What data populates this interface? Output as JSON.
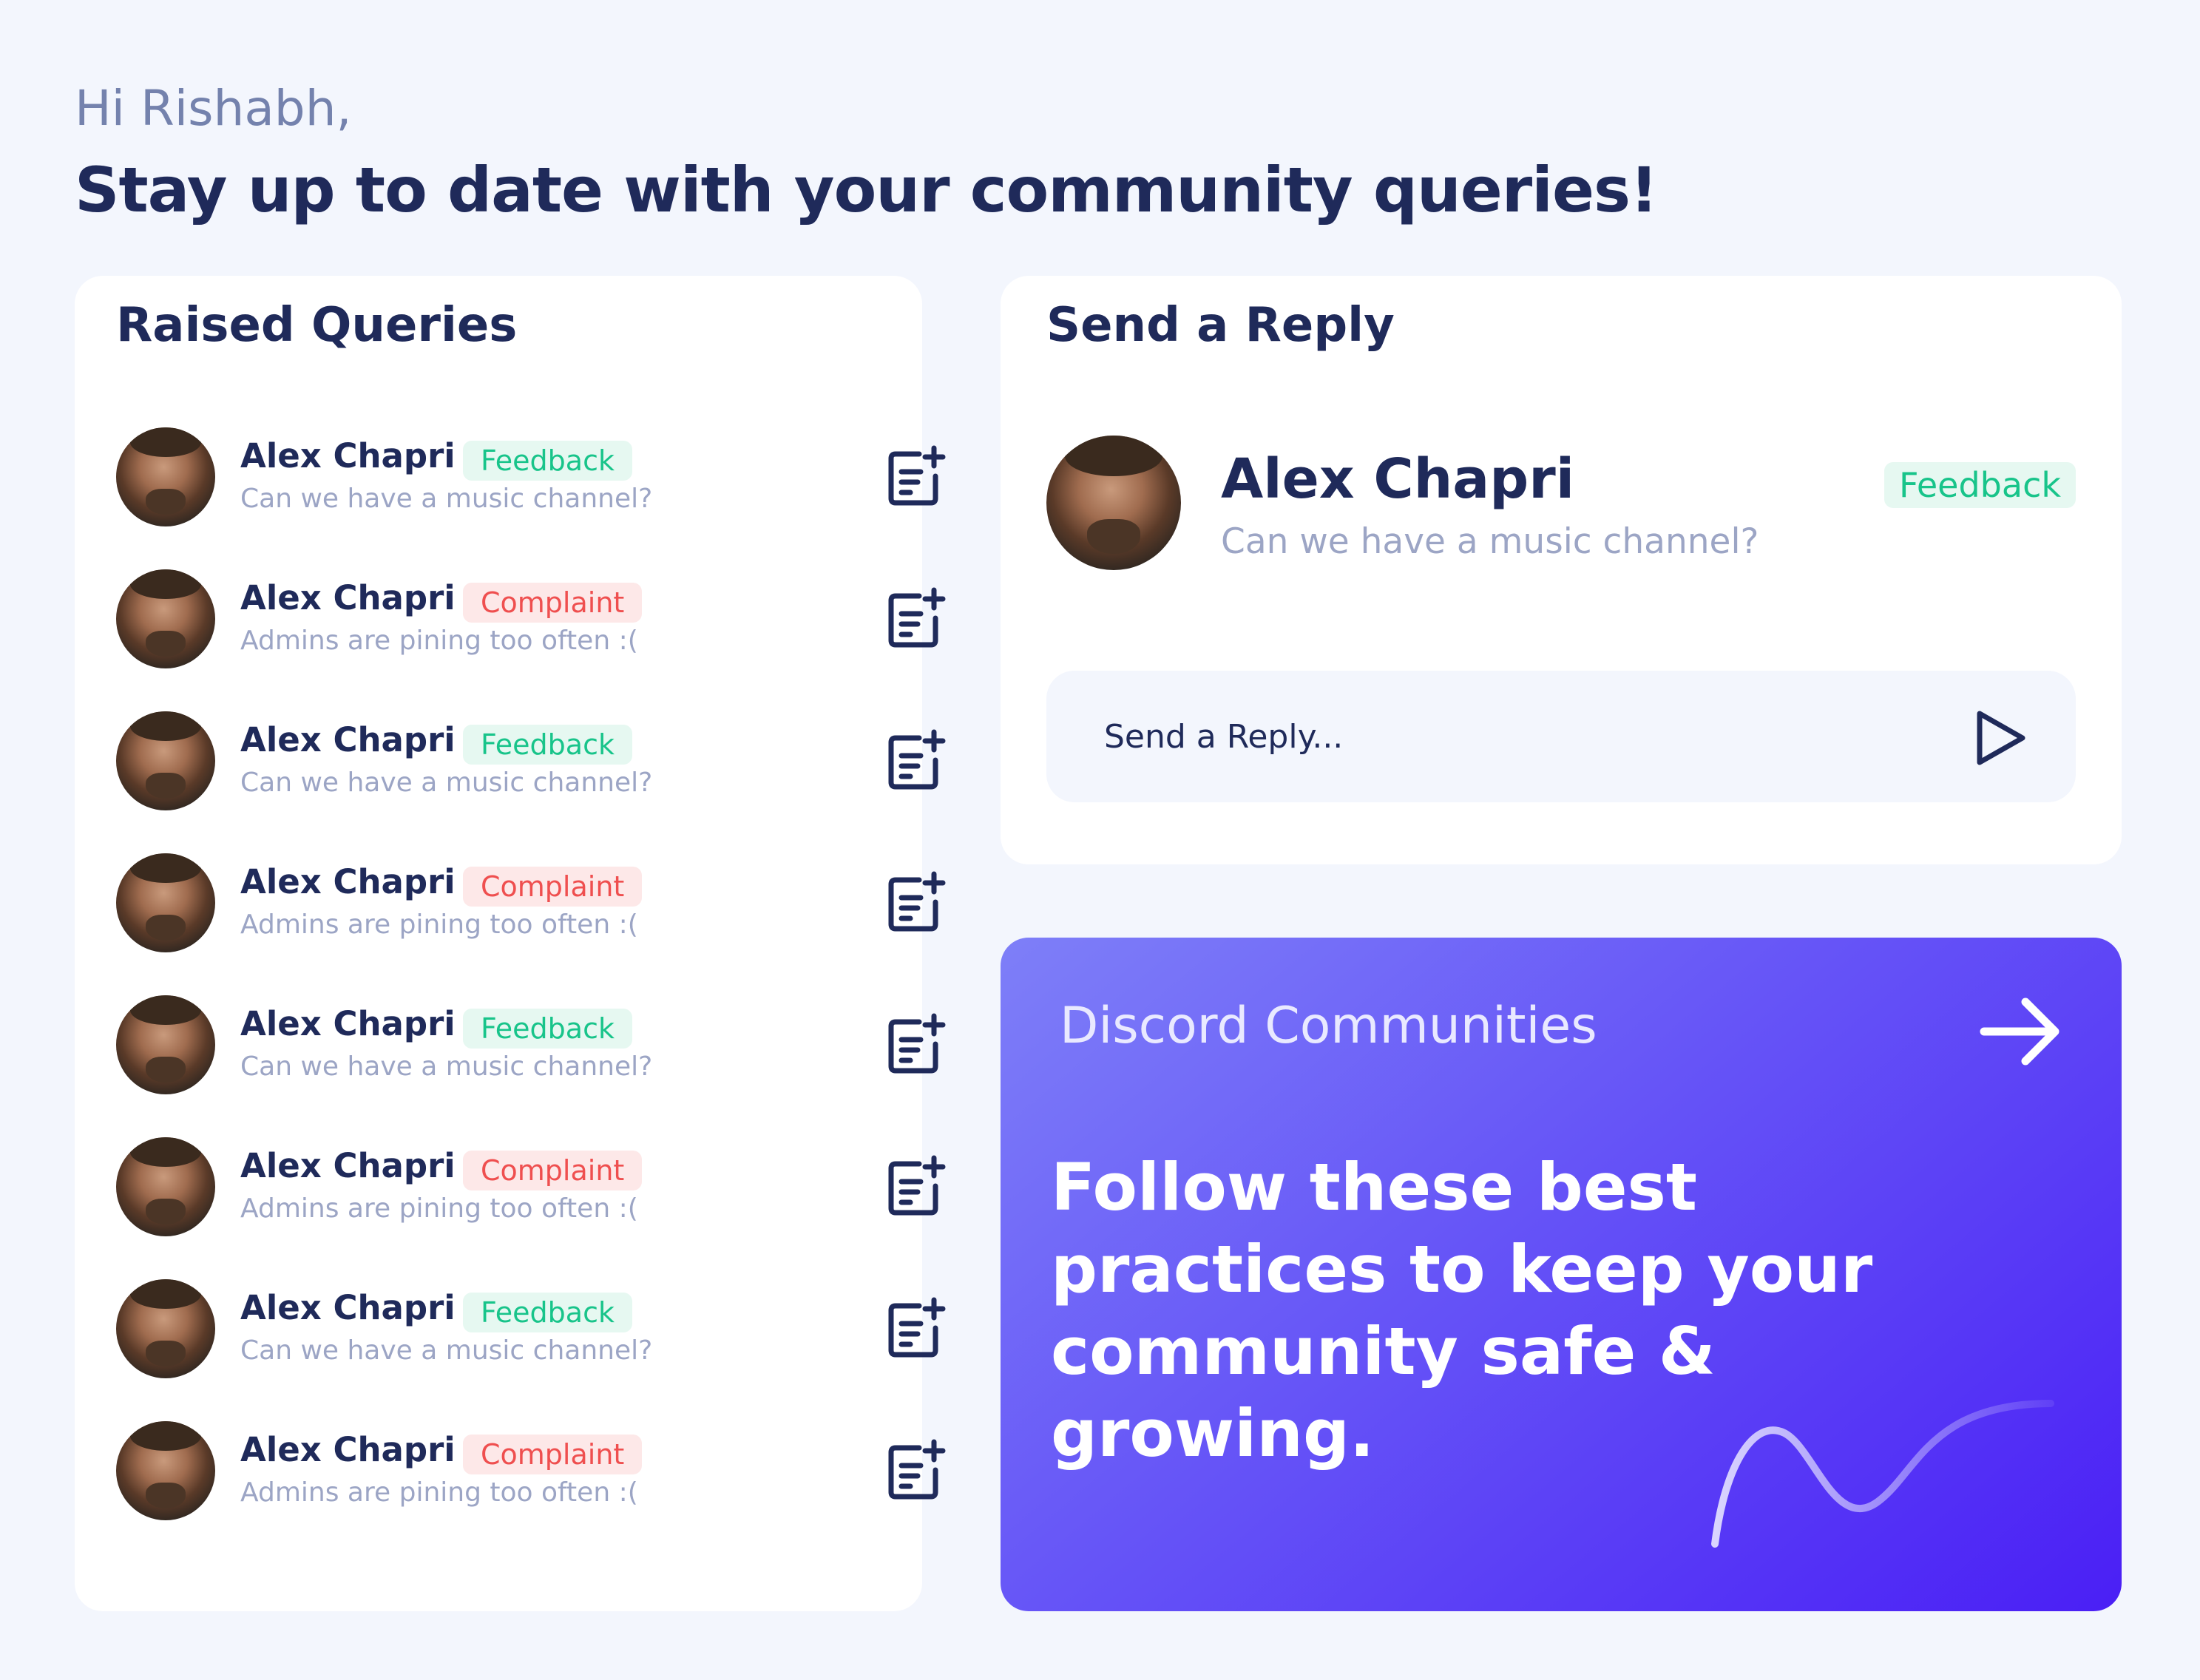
{
  "header": {
    "greeting": "Hi Rishabh,",
    "headline": "Stay up to date with your community queries!"
  },
  "queries": {
    "title": "Raised Queries",
    "items": [
      {
        "name": "Alex Chapri",
        "tag": "Feedback",
        "tag_type": "feedback",
        "message": "Can we have a music channel?"
      },
      {
        "name": "Alex Chapri",
        "tag": "Complaint",
        "tag_type": "complaint",
        "message": "Admins are pining too often :("
      },
      {
        "name": "Alex Chapri",
        "tag": "Feedback",
        "tag_type": "feedback",
        "message": "Can we have a music channel?"
      },
      {
        "name": "Alex Chapri",
        "tag": "Complaint",
        "tag_type": "complaint",
        "message": "Admins are pining too often :("
      },
      {
        "name": "Alex Chapri",
        "tag": "Feedback",
        "tag_type": "feedback",
        "message": "Can we have a music channel?"
      },
      {
        "name": "Alex Chapri",
        "tag": "Complaint",
        "tag_type": "complaint",
        "message": "Admins are pining too often :("
      },
      {
        "name": "Alex Chapri",
        "tag": "Feedback",
        "tag_type": "feedback",
        "message": "Can we have a music channel?"
      },
      {
        "name": "Alex Chapri",
        "tag": "Complaint",
        "tag_type": "complaint",
        "message": "Admins are pining too often :("
      }
    ],
    "row_icon": "note-add-icon"
  },
  "reply": {
    "title": "Send a Reply",
    "name": "Alex Chapri",
    "message": "Can we have a music channel?",
    "tag": "Feedback",
    "input_placeholder": "Send a Reply...",
    "send_icon": "send-icon"
  },
  "discord": {
    "title": "Discord Communities",
    "text": "Follow these best practices to keep your community safe & growing.",
    "arrow_icon": "arrow-right-icon"
  },
  "colors": {
    "background": "#f3f6fd",
    "primary_text": "#1f2a5a",
    "muted_text": "#9ca5c5",
    "feedback": "#18c48a",
    "feedback_bg": "#e6f8f1",
    "complaint": "#ef4f4f",
    "complaint_bg": "#fde8e8",
    "accent_gradient_start": "#7e7ff8",
    "accent_gradient_end": "#4a1ff5"
  }
}
